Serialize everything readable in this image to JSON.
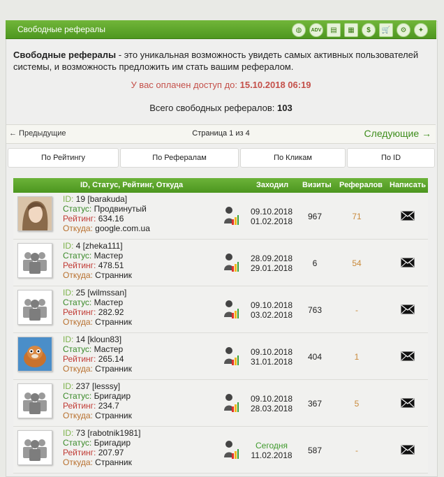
{
  "window": {
    "title": "Свободные рефералы",
    "icons": [
      "globe-icon",
      "adv-icon",
      "table-icon",
      "grid-icon",
      "dollar-icon",
      "cart-icon",
      "settings-gear-icon",
      "lightbulb-icon"
    ]
  },
  "intro": {
    "bold": "Свободные рефералы",
    "text": " - это уникальная возможность увидеть самых активных пользователей системы, и возможность предложить им стать вашим рефералом.",
    "access_label": "У вас оплачен доступ до: ",
    "access_date": "15.10.2018 06:19",
    "total_label": "Всего свободных рефералов: ",
    "total_value": "103"
  },
  "pager": {
    "prev": "← Предыдущие",
    "page": "Страница 1 из 4",
    "next": "Следующие →"
  },
  "sorts": [
    "По Рейтингу",
    "По Рефералам",
    "По Кликам",
    "По ID"
  ],
  "table": {
    "headers": [
      "ID, Статус, Рейтинг, Откуда",
      "Заходил",
      "Визиты",
      "Рефералов",
      "Написать"
    ],
    "labels": {
      "id": "ID: ",
      "status": "Статус: ",
      "rating": "Рейтинг: ",
      "from": "Откуда: "
    },
    "rows": [
      {
        "id": "19 [barakuda]",
        "status": "Продвинутый",
        "rating": "634.16",
        "from": "google.com.ua",
        "date1": "09.10.2018",
        "date2": "01.02.2018",
        "visits": "967",
        "refs": "71",
        "avatar": "woman-photo"
      },
      {
        "id": "4 [zheka111]",
        "status": "Мастер",
        "rating": "478.51",
        "from": "Странник",
        "date1": "28.09.2018",
        "date2": "29.01.2018",
        "visits": "6",
        "refs": "54",
        "avatar": "default"
      },
      {
        "id": "25 [wilmssan]",
        "status": "Мастер",
        "rating": "282.92",
        "from": "Странник",
        "date1": "09.10.2018",
        "date2": "03.02.2018",
        "visits": "763",
        "refs": "-",
        "avatar": "default"
      },
      {
        "id": "14 [kloun83]",
        "status": "Мастер",
        "rating": "265.14",
        "from": "Странник",
        "date1": "09.10.2018",
        "date2": "31.01.2018",
        "visits": "404",
        "refs": "1",
        "avatar": "squirrel"
      },
      {
        "id": "237 [lesssy]",
        "status": "Бригадир",
        "rating": "234.7",
        "from": "Странник",
        "date1": "09.10.2018",
        "date2": "28.03.2018",
        "visits": "367",
        "refs": "5",
        "avatar": "default"
      },
      {
        "id": "73 [rabotnik1981]",
        "status": "Бригадир",
        "rating": "207.97",
        "from": "Странник",
        "date1": "Сегодня",
        "date2": "11.02.2018",
        "visits": "587",
        "refs": "-",
        "avatar": "default"
      }
    ]
  }
}
